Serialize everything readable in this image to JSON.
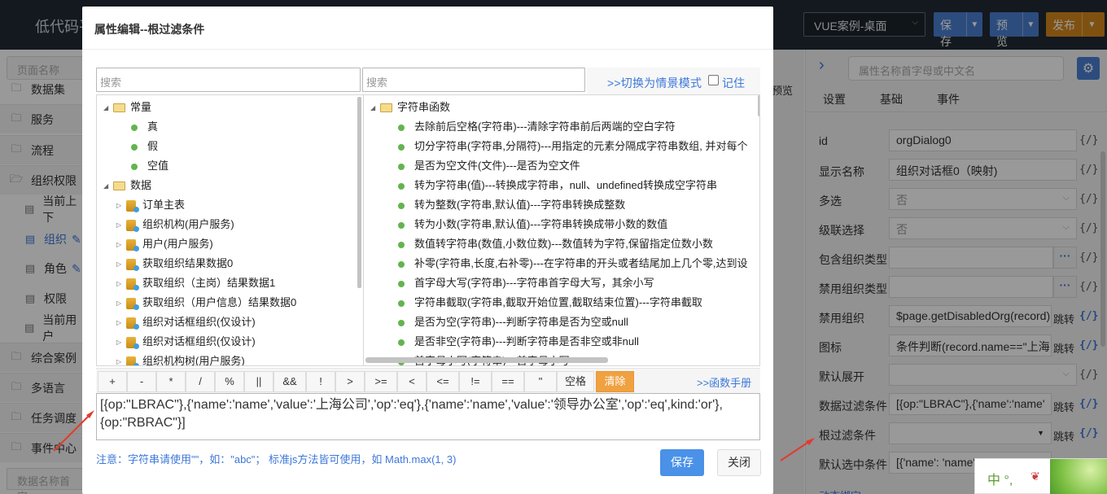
{
  "app": {
    "title": "低代码平"
  },
  "topbar": {
    "case_select": "VUE案例-桌面",
    "save_label": "保存",
    "preview_label": "预览",
    "publish_label": "发布"
  },
  "sidebar": {
    "search_placeholder": "页面名称",
    "items": [
      {
        "label": "数据集"
      },
      {
        "label": "服务"
      },
      {
        "label": "流程"
      },
      {
        "label": "组织权限"
      },
      {
        "label": "当前上下"
      },
      {
        "label": "组织"
      },
      {
        "label": "角色"
      },
      {
        "label": "权限"
      },
      {
        "label": "当前用户"
      },
      {
        "label": "综合案例"
      },
      {
        "label": "多语言"
      },
      {
        "label": "任务调度"
      },
      {
        "label": "事件中心"
      }
    ],
    "bottom_search_placeholder": "数据名称首字"
  },
  "center": {
    "preview_label": "预览"
  },
  "right_panel": {
    "search_placeholder": "属性名称首字母或中文名",
    "tabs": [
      "设置",
      "基础",
      "事件"
    ],
    "fx": "{/}",
    "jump": "跳转",
    "props": [
      {
        "label": "id",
        "value": "orgDialog0"
      },
      {
        "label": "显示名称",
        "value": "组织对话框0（映射)"
      },
      {
        "label": "多选",
        "value": "否"
      },
      {
        "label": "级联选择",
        "value": "否"
      },
      {
        "label": "包含组织类型",
        "value": ""
      },
      {
        "label": "禁用组织类型",
        "value": ""
      },
      {
        "label": "禁用组织",
        "value": "$page.getDisabledOrg(record)"
      },
      {
        "label": "图标",
        "value": "条件判断(record.name==\"上海"
      },
      {
        "label": "默认展开",
        "value": ""
      },
      {
        "label": "数据过滤条件",
        "value": "[{op:\"LBRAC\"},{'name':'name'"
      },
      {
        "label": "根过滤条件",
        "value": ""
      },
      {
        "label": "默认选中条件",
        "value": "[{'name': 'name'"
      }
    ],
    "more_label": "动态绑定"
  },
  "dialog": {
    "title": "属性编辑--根过滤条件",
    "search1_placeholder": "搜索",
    "search2_placeholder": "搜索",
    "mode_link": ">>切换为情景模式",
    "remember_label": "记住",
    "left_tree": {
      "constants_label": "常量",
      "constants": [
        "真",
        "假",
        "空值"
      ],
      "data_label": "数据",
      "data_items": [
        "订单主表",
        "组织机构(用户服务)",
        "用户(用户服务)",
        "获取组织结果数据0",
        "获取组织（主岗）结果数据1",
        "获取组织（用户信息）结果数据0",
        "组织对话框组织(仅设计)",
        "组织对话框组织(仅设计)",
        "组织机构树(用户服务)"
      ]
    },
    "right_tree": {
      "group_label": "字符串函数",
      "items": [
        "去除前后空格(字符串)---清除字符串前后两端的空白字符",
        "切分字符串(字符串,分隔符)---用指定的元素分隔成字符串数组, 并对每个",
        "是否为空文件(文件)---是否为空文件",
        "转为字符串(值)---转换成字符串，null、undefined转换成空字符串",
        "转为整数(字符串,默认值)---字符串转换成整数",
        "转为小数(字符串,默认值)---字符串转换成带小数的数值",
        "数值转字符串(数值,小数位数)---数值转为字符,保留指定位数小数",
        "补零(字符串,长度,右补零)---在字符串的开头或者结尾加上几个零,达到设",
        "首字母大写(字符串)---字符串首字母大写，其余小写",
        "字符串截取(字符串,截取开始位置,截取结束位置)---字符串截取",
        "是否为空(字符串)---判断字符串是否为空或null",
        "是否非空(字符串)---判断字符串是否非空或非null",
        "首字母小写(字符串)---首字母小写"
      ]
    },
    "operators": [
      "+",
      "-",
      "*",
      "/",
      "%",
      "||",
      "&&",
      "!",
      ">",
      ">=",
      "<",
      "<=",
      "!=",
      "==",
      "\"",
      "空格"
    ],
    "clear_label": "清除",
    "manual_link": ">>函数手册",
    "expression": "[{op:\"LBRAC\"},{'name':'name','value':'上海公司','op':'eq'},{'name':'name','value':'领导办公室','op':'eq',kind:'or'},{op:\"RBRAC\"}]",
    "note": "注意：字符串请使用\"\"，如：\"abc\"；  标准js方法皆可使用，如 Math.max(1, 3)",
    "save_label": "保存",
    "close_label": "关闭"
  },
  "ime": {
    "text": "中  °,"
  },
  "colors": {
    "accent": "#4a7fd3",
    "publish": "#d4871d",
    "clear": "#f0a141",
    "arrow": "#e23b2e"
  }
}
